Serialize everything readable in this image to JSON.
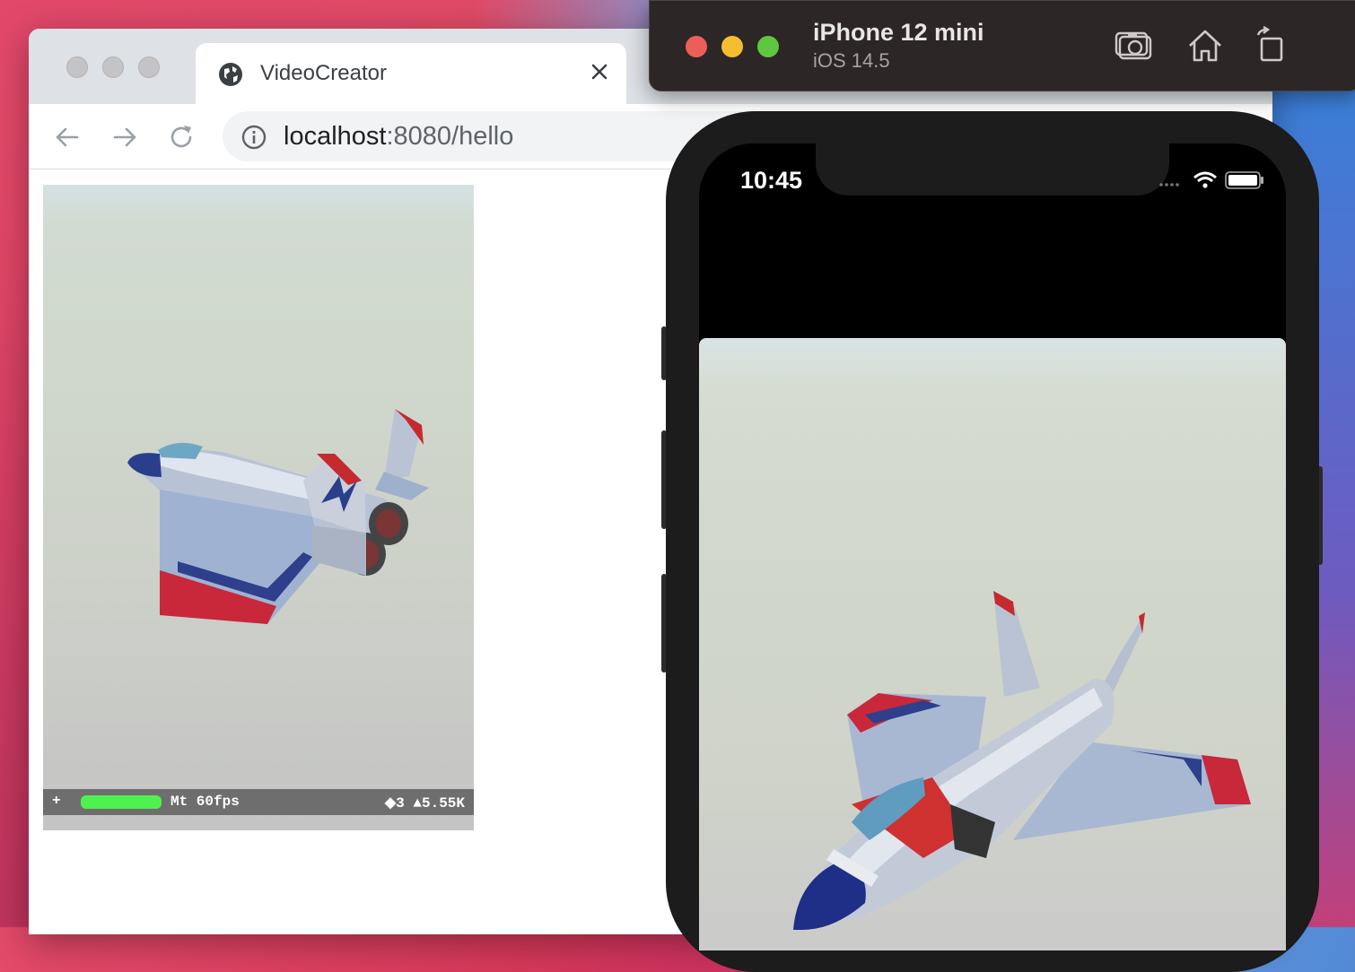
{
  "browser": {
    "tab_title": "VideoCreator",
    "url_host": "localhost",
    "url_rest": ":8080/hello"
  },
  "canvas": {
    "stats_plus": "+",
    "stats_fps": "Mt 60fps",
    "stats_tris": "◆3 ▲5.55K"
  },
  "simulator": {
    "device": "iPhone 12 mini",
    "os": "iOS 14.5",
    "buttons": [
      "screenshot-icon",
      "home-icon",
      "rotate-icon"
    ]
  },
  "phone": {
    "time": "10:45"
  },
  "colors": {
    "close": "#ec5f57",
    "minimize": "#f5be30",
    "zoom": "#5fc73e"
  }
}
